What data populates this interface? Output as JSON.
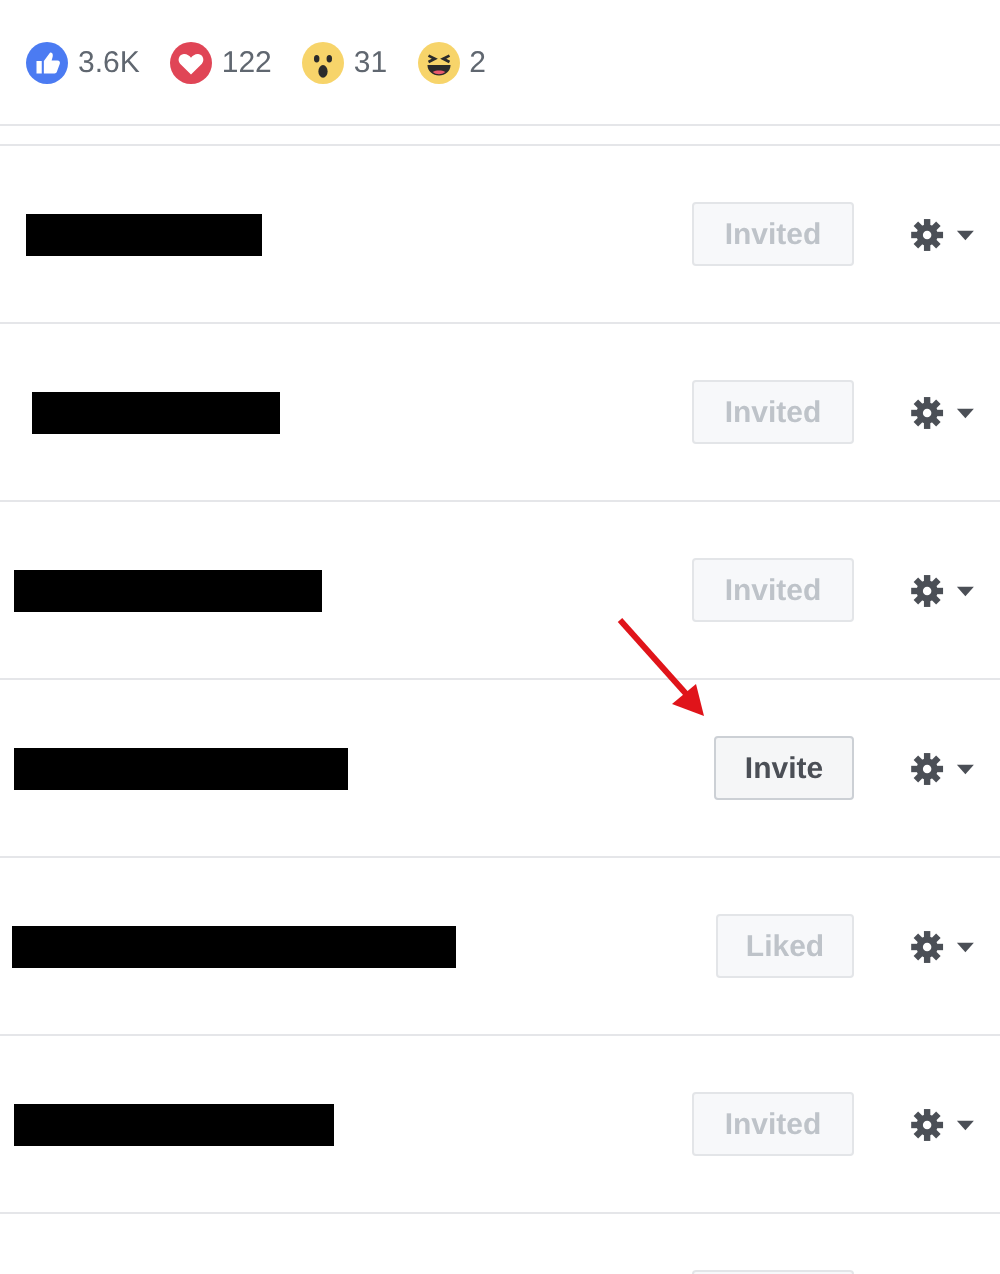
{
  "reactions": [
    {
      "kind": "like",
      "count": "3.6K"
    },
    {
      "kind": "love",
      "count": "122"
    },
    {
      "kind": "wow",
      "count": "31"
    },
    {
      "kind": "haha",
      "count": "2"
    }
  ],
  "people": [
    {
      "button": {
        "label": "Invited",
        "disabled": true
      },
      "settings_menu": true
    },
    {
      "button": {
        "label": "Invited",
        "disabled": true
      },
      "settings_menu": true
    },
    {
      "button": {
        "label": "Invited",
        "disabled": true
      },
      "settings_menu": true
    },
    {
      "button": {
        "label": "Invite",
        "disabled": false
      },
      "arrow": true,
      "settings_menu": true
    },
    {
      "button": {
        "label": "Liked",
        "disabled": true
      },
      "settings_menu": true
    },
    {
      "button": {
        "label": "Invited",
        "disabled": true
      },
      "settings_menu": true
    },
    {
      "button": {
        "disabled": true
      }
    }
  ]
}
